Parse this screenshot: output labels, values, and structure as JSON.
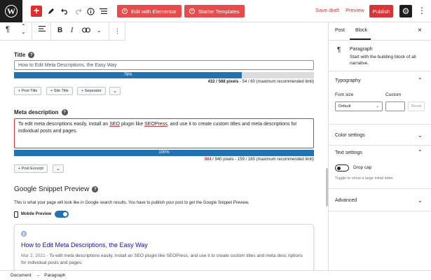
{
  "topbar": {
    "elementor_label": "Edit with Elementor",
    "starter_label": "Starter Templates",
    "save_draft": "Save draft",
    "preview": "Preview",
    "publish": "Publish"
  },
  "title_field": {
    "label": "Title",
    "value": "How to Edit Meta Descriptions, the Easy Way",
    "progress_percent": 76,
    "progress_label": "76%",
    "counter_pixels": "432 / 568 pixels",
    "counter_rest": " - 54 / 60 (maximum recommended limit)",
    "chips": [
      "+ Post Title",
      "+ Site Title",
      "+ Separator"
    ]
  },
  "meta_field": {
    "label": "Meta description",
    "text_before_1": "To edit meta descriptions easily, install an ",
    "link_1": "SEO",
    "text_before_2": " plugin like ",
    "link_2": "SEOPress",
    "text_after": ", and use it to create custom titles and meta descriptions for individual posts and pages.",
    "progress_percent": 100,
    "progress_label": "100%",
    "counter_pixels": "984",
    "counter_rest": " / 940 pixels - 159 / 160 (maximum recommended limit)",
    "chips": [
      "+ Post Excerpt"
    ]
  },
  "snippet": {
    "heading": "Google Snippet Preview",
    "note": "This is what your page will look like in Google search results. You have to publish your post to get the Google Snippet Preview.",
    "mobile_label": "Mobile Preview",
    "title": "How to Edit Meta Descriptions, the Easy Way",
    "date": "Mar 2, 2021",
    "desc": " - To edit meta descriptions easily, install an SEO plugin like SEOPress, and use it to create custom titles and meta desc riptions for individual posts and pages."
  },
  "sidebar": {
    "tab_post": "Post",
    "tab_block": "Block",
    "block_name": "Paragraph",
    "block_desc": "Start with the building block of all narrative.",
    "typography": "Typography",
    "font_size": "Font size",
    "custom": "Custom",
    "font_default": "Default",
    "reset": "Reset",
    "color_settings": "Color settings",
    "text_settings": "Text settings",
    "drop_cap": "Drop cap",
    "drop_cap_help": "Toggle to show a large initial letter.",
    "advanced": "Advanced"
  },
  "footer": {
    "crumb_1": "Document",
    "sep": "→",
    "crumb_2": "Paragraph"
  }
}
